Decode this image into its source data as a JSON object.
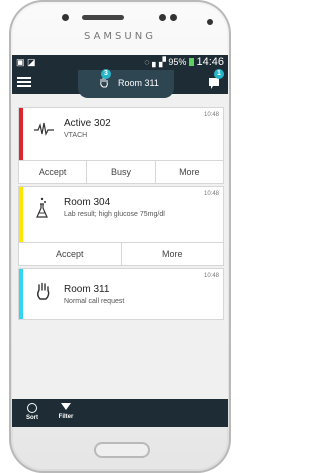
{
  "device": {
    "brand": "SAMSUNG"
  },
  "status_bar": {
    "signal": "95%",
    "time": "14:46"
  },
  "header": {
    "title": "Room 311",
    "tab_badge": "3",
    "chat_badge": "1"
  },
  "cards": [
    {
      "title": "Active 302",
      "subtitle": "VTACH",
      "time": "10:48",
      "stripe_color": "#e0242b",
      "icon": "ecg-waveform-icon",
      "actions": [
        "Accept",
        "Busy",
        "More"
      ]
    },
    {
      "title": "Room 304",
      "subtitle": "Lab result; high glucose 75mg/dl",
      "time": "10:48",
      "stripe_color": "#ffe600",
      "icon": "lab-flask-icon",
      "actions": [
        "Accept",
        "More"
      ]
    },
    {
      "title": "Room 311",
      "subtitle": "Normal call request",
      "time": "10:48",
      "stripe_color": "#33d6f2",
      "icon": "hand-icon",
      "actions": []
    }
  ],
  "bottom_bar": {
    "sort": "Sort",
    "filter": "Filter"
  }
}
